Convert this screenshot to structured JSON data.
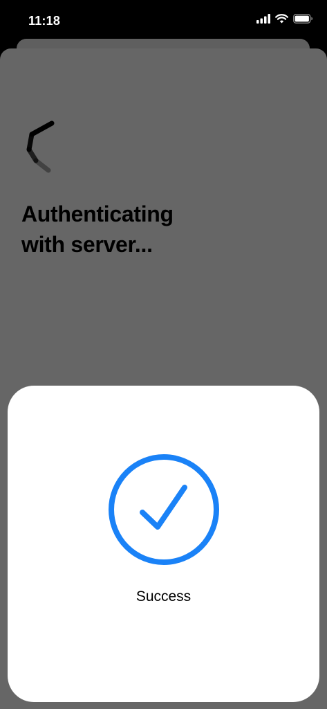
{
  "status_bar": {
    "time": "11:18",
    "icons": [
      "signal-bars-icon",
      "wifi-icon",
      "battery-icon"
    ]
  },
  "auth_screen": {
    "spinner_icon": "loading-spinner-icon",
    "title": "Authenticating\nwith server..."
  },
  "success_card": {
    "icon": "checkmark-circle-icon",
    "label": "Success",
    "accent_color": "#1a82f7"
  }
}
